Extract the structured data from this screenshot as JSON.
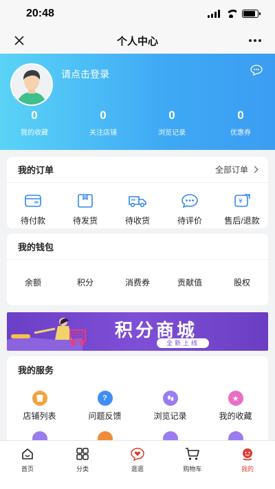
{
  "status_bar": {
    "time": "20:48"
  },
  "nav": {
    "title": "个人中心"
  },
  "header": {
    "login_prompt": "请点击登录",
    "stats": [
      {
        "value": "0",
        "label": "我的收藏"
      },
      {
        "value": "0",
        "label": "关注店铺"
      },
      {
        "value": "0",
        "label": "浏览记录"
      },
      {
        "value": "0",
        "label": "优惠券"
      }
    ]
  },
  "orders": {
    "title": "我的订单",
    "all_link": "全部订单",
    "items": [
      {
        "label": "待付款",
        "icon": "wallet-icon"
      },
      {
        "label": "待发货",
        "icon": "package-icon"
      },
      {
        "label": "待收货",
        "icon": "truck-icon"
      },
      {
        "label": "待评价",
        "icon": "comment-icon"
      },
      {
        "label": "售后/退款",
        "icon": "refund-icon"
      }
    ]
  },
  "wallet": {
    "title": "我的钱包",
    "items": [
      "余额",
      "积分",
      "消费券",
      "贡献值",
      "股权"
    ]
  },
  "banner": {
    "title": "积分商城",
    "subtitle": "全新上线"
  },
  "services": {
    "title": "我的服务",
    "items": [
      {
        "label": "店铺列表",
        "icon": "store-icon",
        "color": "#f4a340"
      },
      {
        "label": "问题反馈",
        "icon": "question-icon",
        "color": "#3e8ef5"
      },
      {
        "label": "浏览记录",
        "icon": "footprint-icon",
        "color": "#9a7cf0"
      },
      {
        "label": "我的收藏",
        "icon": "star-icon",
        "color": "#e86fc5"
      }
    ],
    "row2_colors": [
      "#9a7cf0",
      "#f08c3a",
      "#9a7cf0",
      "#9a7cf0"
    ]
  },
  "tab_bar": {
    "items": [
      {
        "label": "首页",
        "icon": "home-icon"
      },
      {
        "label": "分类",
        "icon": "grid-icon"
      },
      {
        "label": "逛逛",
        "icon": "heart-chat-icon"
      },
      {
        "label": "购物车",
        "icon": "cart-icon"
      },
      {
        "label": "我的",
        "icon": "profile-icon"
      }
    ],
    "active_color": "#e23a2e"
  },
  "colors": {
    "header_start": "#5ad3f6",
    "header_end": "#3b9df2",
    "accent_blue": "#2f86f0"
  }
}
